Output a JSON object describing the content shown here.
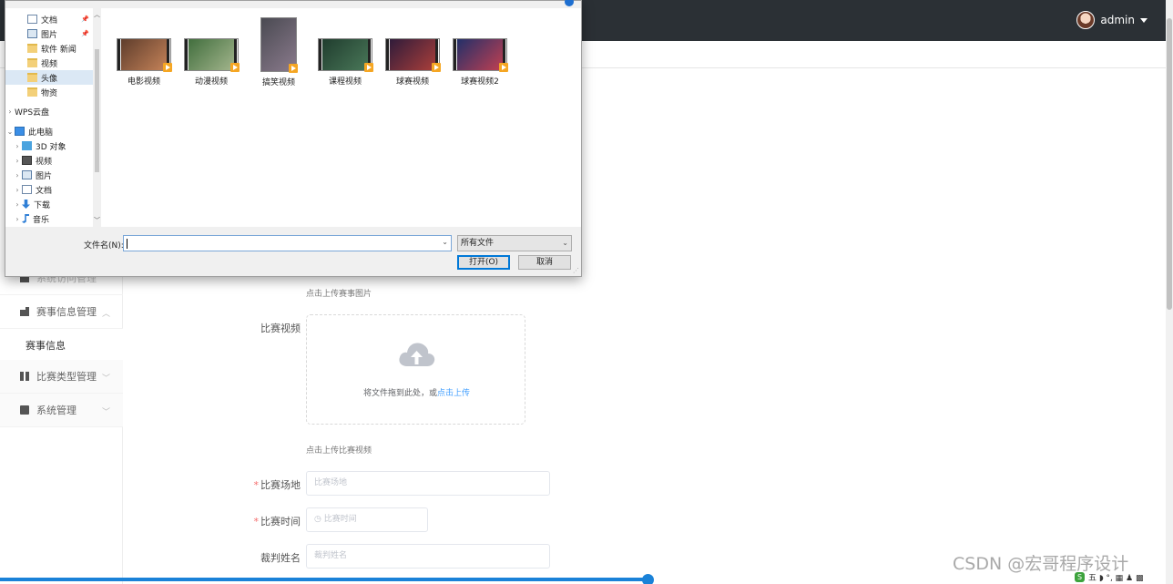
{
  "header": {
    "username": "admin"
  },
  "sidebar": {
    "items": [
      {
        "label": "系统访问管理",
        "faded": true
      },
      {
        "label": "赛事信息管理",
        "expanded": true
      },
      {
        "label": "赛事信息",
        "sub": true
      },
      {
        "label": "比赛类型管理"
      },
      {
        "label": "系统管理"
      }
    ]
  },
  "form": {
    "image_hint": "点击上传赛事图片",
    "video_label": "比赛视频",
    "upload_text": "将文件拖到此处，或",
    "upload_link": "点击上传",
    "video_hint": "点击上传比赛视频",
    "venue_label": "比赛场地",
    "venue_placeholder": "比赛场地",
    "time_label": "比赛时间",
    "time_placeholder": "比赛时间",
    "referee_label": "裁判姓名",
    "referee_placeholder": "裁判姓名",
    "required_mark": "*"
  },
  "dialog": {
    "tree": [
      {
        "label": "文档",
        "icon": "document-icon",
        "pinned": true
      },
      {
        "label": "图片",
        "icon": "picture-icon",
        "pinned": true
      },
      {
        "label": "软件 新闻",
        "icon": "folder-icon"
      },
      {
        "label": "视频",
        "icon": "folder-icon"
      },
      {
        "label": "头像",
        "icon": "folder-icon",
        "selected": true
      },
      {
        "label": "物资",
        "icon": "folder-icon"
      },
      {
        "label": "WPS云盘",
        "icon": "cloud-icon",
        "arrow": "›"
      },
      {
        "label": "此电脑",
        "icon": "computer-icon",
        "arrow": "⌄"
      },
      {
        "label": "3D 对象",
        "icon": "cube-icon",
        "arrow": "›"
      },
      {
        "label": "视频",
        "icon": "film-icon",
        "arrow": "›"
      },
      {
        "label": "图片",
        "icon": "picture-icon",
        "arrow": "›"
      },
      {
        "label": "文档",
        "icon": "document-icon",
        "arrow": "›"
      },
      {
        "label": "下载",
        "icon": "download-icon",
        "arrow": "›"
      },
      {
        "label": "音乐",
        "icon": "music-icon",
        "arrow": "›"
      }
    ],
    "files": [
      {
        "name": "电影视频",
        "colors": [
          "#5a3a2a",
          "#c9855a"
        ]
      },
      {
        "name": "动漫视频",
        "colors": [
          "#3d6b3a",
          "#a7b890"
        ]
      },
      {
        "name": "搞笑视频",
        "colors": [
          "#4a4a52",
          "#8a7a8c"
        ]
      },
      {
        "name": "课程视频",
        "colors": [
          "#1e3a2c",
          "#4b7a5a"
        ]
      },
      {
        "name": "球赛视频",
        "colors": [
          "#2a1a3a",
          "#b0403a"
        ]
      },
      {
        "name": "球赛视频2",
        "colors": [
          "#1b2f6a",
          "#c84050"
        ]
      }
    ],
    "filename_label": "文件名(N):",
    "filename_value": "",
    "filetype": "所有文件",
    "open_button": "打开(O)",
    "cancel_button": "取消"
  },
  "watermark": "CSDN @宏哥程序设计",
  "tray": {
    "ime": "S",
    "text": "五 ◗ °, ▦ ♟ ▩"
  }
}
